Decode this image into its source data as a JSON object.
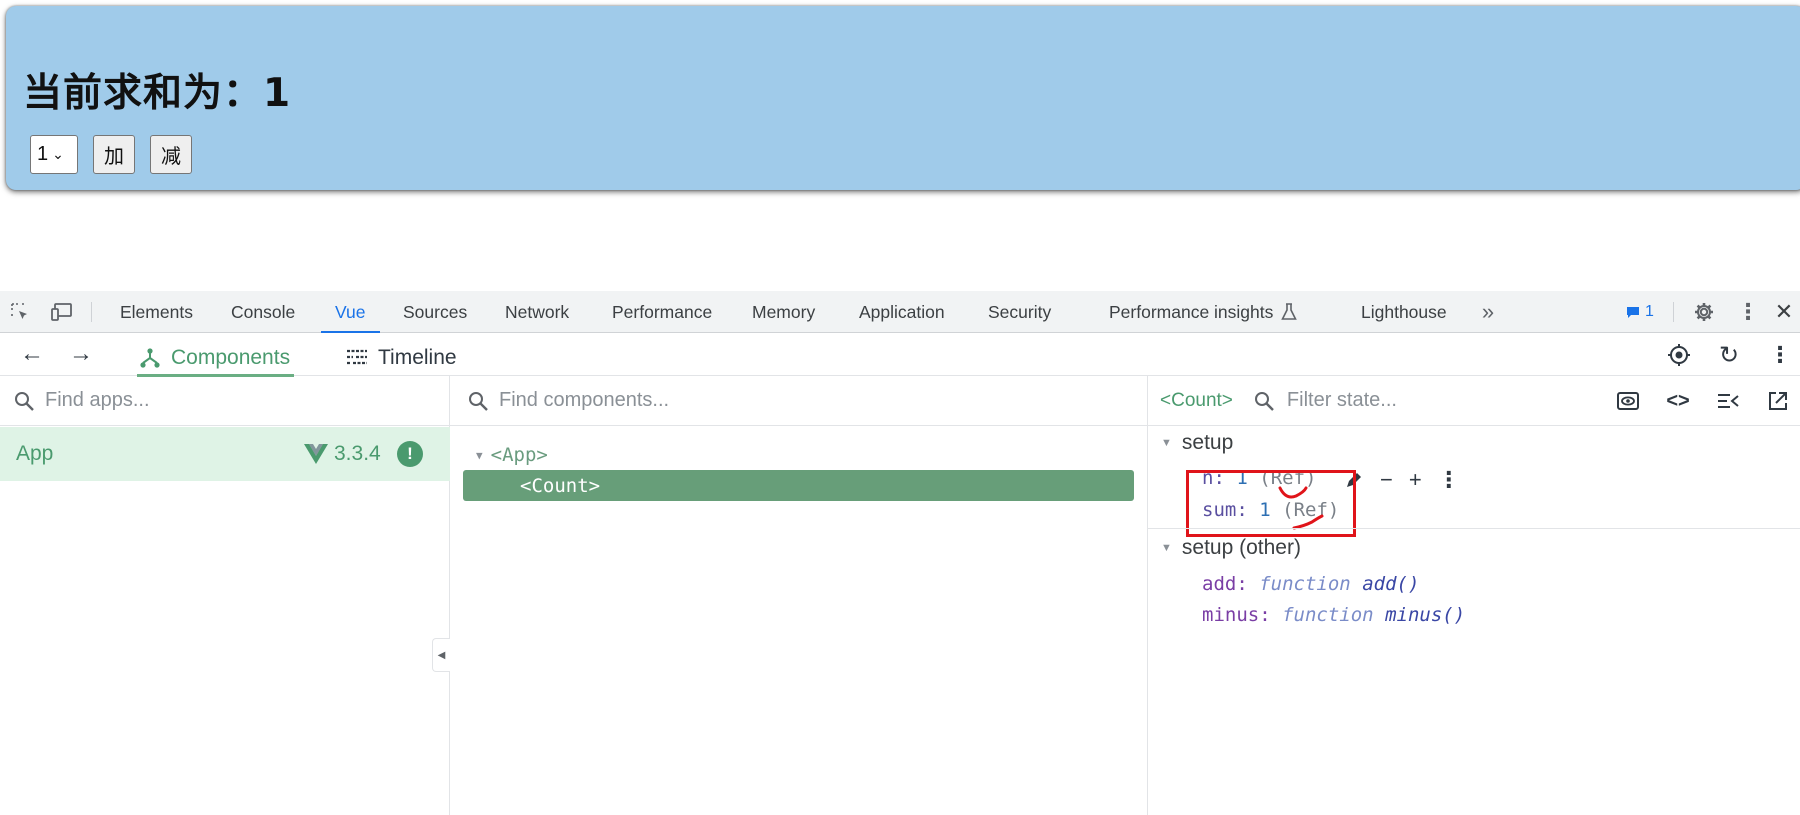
{
  "page": {
    "heading": "当前求和为：1",
    "select_value": "1",
    "add_label": "加",
    "minus_label": "减"
  },
  "devtools": {
    "tabs": [
      "Elements",
      "Console",
      "Vue",
      "Sources",
      "Network",
      "Performance",
      "Memory",
      "Application",
      "Security",
      "Performance insights",
      "Lighthouse"
    ],
    "active_tab": "Vue",
    "issues_count": "1",
    "vue": {
      "nav": {
        "components": "Components",
        "timeline": "Timeline"
      },
      "apps": {
        "placeholder": "Find apps...",
        "items": [
          {
            "name": "App",
            "version": "3.3.4",
            "badge": "!"
          }
        ]
      },
      "tree": {
        "placeholder": "Find components...",
        "root": "<App>",
        "selected": "<Count>"
      },
      "state": {
        "component": "<Count>",
        "placeholder": "Filter state...",
        "sections": [
          {
            "title": "setup",
            "props": [
              {
                "key": "n",
                "value": "1",
                "type": "(Ref)"
              },
              {
                "key": "sum",
                "value": "1",
                "type": "(Ref)"
              }
            ]
          },
          {
            "title": "setup (other)",
            "props": [
              {
                "key": "add",
                "keyword": "function",
                "value": "add()"
              },
              {
                "key": "minus",
                "keyword": "function",
                "value": "minus()"
              }
            ]
          }
        ]
      }
    }
  },
  "colors": {
    "page_card": "#a0cbea",
    "vue_green": "#4a9a6e",
    "selected_row": "#679e79",
    "annotation": "#e0141a",
    "active_tab": "#1a73e8"
  }
}
